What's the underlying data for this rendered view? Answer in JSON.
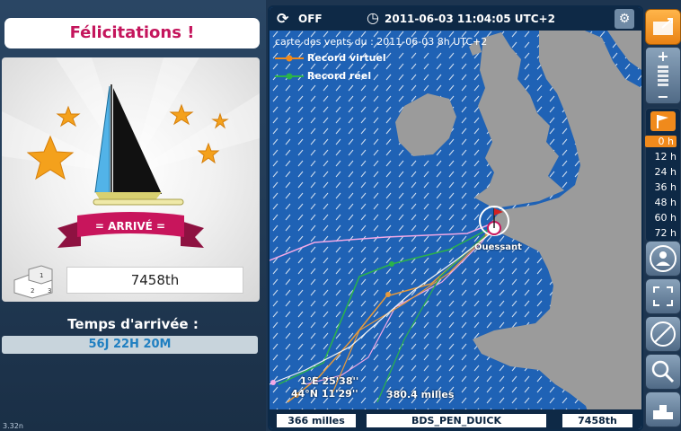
{
  "left_panel": {
    "title": "Félicitations !",
    "badge": "ARRIVÉ",
    "rank": "7458th",
    "podium_numbers": [
      "2",
      "1",
      "3"
    ],
    "arrival_label": "Temps d'arrivée :",
    "arrival_time": "56J 22H 20M",
    "version": "3.32n"
  },
  "map": {
    "toggle_label": "OFF",
    "datetime": "2011-06-03 11:04:05 UTC+2",
    "wind_date": "carte des vents du : 2011-06-03 8h UTC+2",
    "legend": [
      {
        "label": "Record virtuel",
        "color": "#f08a1c"
      },
      {
        "label": "Record réel",
        "color": "#2bb34a"
      }
    ],
    "place_label": "Ouessant",
    "coord_lon": "1°E 25'38''",
    "coord_lat": "44°N 11'29''",
    "distance_label": "380.4 milles",
    "track_colors": {
      "player": "#f2a8e6",
      "virtual": "#e89a3a",
      "real": "#2bb34a",
      "other": "#f5f5f5"
    }
  },
  "bottom_bar": {
    "distance": "366 milles",
    "boat_name": "BDS_PEN_DUICK",
    "rank": "7458th"
  },
  "time_steps": [
    "0 h",
    "12 h",
    "24 h",
    "36 h",
    "48 h",
    "60 h",
    "72 h"
  ],
  "selected_step": "0 h",
  "colors": {
    "accent": "#f08a1c",
    "title": "#c4155c",
    "sea": "#1f62b5",
    "land": "#9b9b9b"
  }
}
